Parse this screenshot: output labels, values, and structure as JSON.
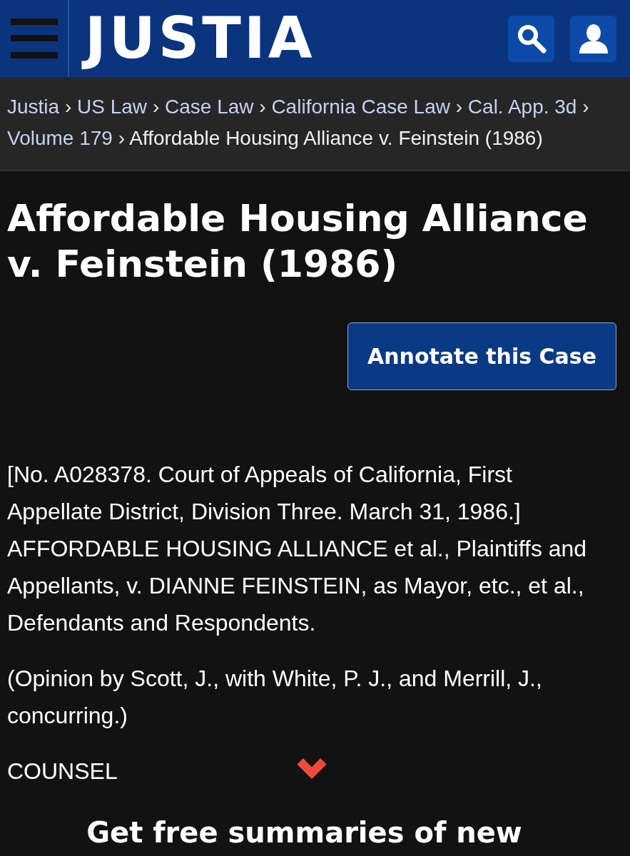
{
  "header": {
    "logo": "JUSTIA"
  },
  "breadcrumb": [
    {
      "label": "Justia",
      "kind": "link"
    },
    {
      "label": "US Law",
      "kind": "link"
    },
    {
      "label": "Case Law",
      "kind": "link"
    },
    {
      "label": "California Case Law",
      "kind": "link"
    },
    {
      "label": "Cal. App. 3d",
      "kind": "link"
    },
    {
      "label": "Volume 179",
      "kind": "link"
    },
    {
      "label": "Affordable Housing Alliance v. Feinstein (1986)",
      "kind": "current"
    }
  ],
  "breadcrumb_separator": "›",
  "title": "Affordable Housing Alliance v. Feinstein (1986)",
  "annotate_button": "Annotate this Case",
  "paragraphs": [
    "[No. A028378. Court of Appeals of California, First Appellate District, Division Three. March 31, 1986.] AFFORDABLE HOUSING ALLIANCE et al., Plaintiffs and Appellants, v. DIANNE FEINSTEIN, as Mayor, etc., et al., Defendants and Respondents.",
    "(Opinion by Scott, J., with White, P. J., and Merrill, J., concurring.)",
    "COUNSEL"
  ],
  "promo_heading": "Get free summaries of new"
}
